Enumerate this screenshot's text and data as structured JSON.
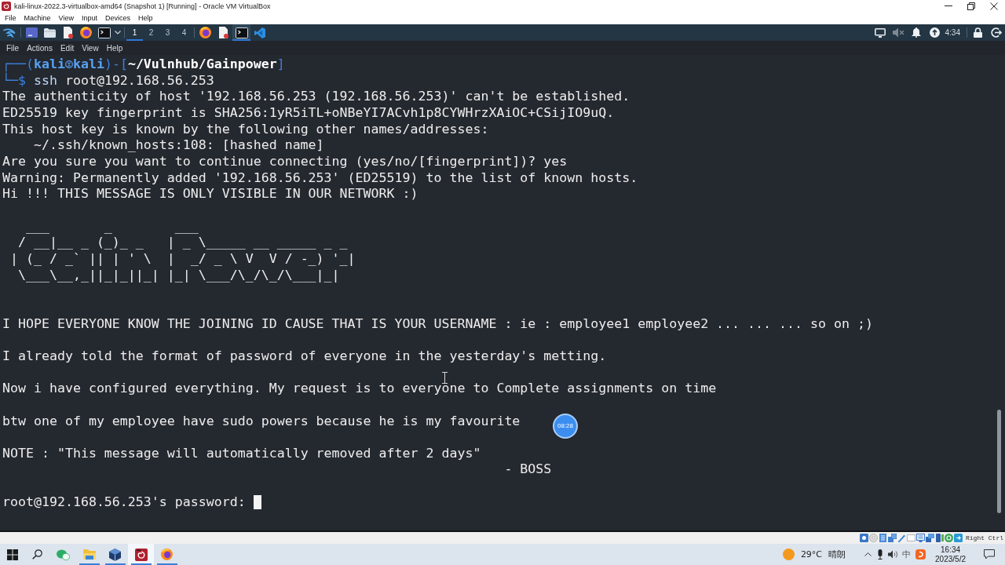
{
  "vm_window": {
    "title": "kali-linux-2022.3-virtualbox-amd64 (Snapshot 1) [Running] - Oracle VM VirtualBox",
    "menu": [
      "File",
      "Machine",
      "View",
      "Input",
      "Devices",
      "Help"
    ],
    "host_key": "Right Ctrl"
  },
  "panel": {
    "workspaces": [
      {
        "label": "1",
        "selected": true
      },
      {
        "label": "2",
        "selected": false
      },
      {
        "label": "3",
        "selected": false
      },
      {
        "label": "4",
        "selected": false
      }
    ],
    "windows": [
      {
        "selected": false
      },
      {
        "selected": false
      },
      {
        "selected": true
      },
      {
        "selected": false
      }
    ],
    "clock": "4:34"
  },
  "terminal": {
    "menu": [
      "File",
      "Actions",
      "Edit",
      "View",
      "Help"
    ],
    "lines": [
      {
        "kind": "prompt",
        "segments": [
          {
            "kind": "frame",
            "text": "┌──("
          },
          {
            "kind": "user",
            "text": "kali"
          },
          {
            "kind": "symbol"
          },
          {
            "kind": "host",
            "text": "kali"
          },
          {
            "kind": "frame",
            "text": ")-["
          },
          {
            "kind": "path",
            "text": "~/Vulnhub/Gainpower"
          },
          {
            "kind": "frame",
            "text": "]"
          }
        ]
      },
      {
        "kind": "prompt",
        "segments": [
          {
            "kind": "frame",
            "text": "└─$"
          },
          {
            "kind": "command",
            "text": "ssh"
          },
          {
            "kind": "argument",
            "text": "root@192.168.56.253"
          }
        ]
      },
      {
        "kind": "output",
        "text": "The authenticity of host '192.168.56.253 (192.168.56.253)' can't be established."
      },
      {
        "kind": "output",
        "text": "ED25519 key fingerprint is SHA256:1yR5iTL+oNBeYI7ACvh1p8CYWHrzXAiOC+CSijIO9uQ."
      },
      {
        "kind": "output",
        "text": "This host key is known by the following other names/addresses:"
      },
      {
        "kind": "indented",
        "text": "~/.ssh/known_hosts:108: [hashed name]"
      },
      {
        "kind": "output",
        "text": "Are you sure you want to continue connecting (yes/no/[fingerprint])? yes"
      },
      {
        "kind": "output",
        "text": "Warning: Permanently added '192.168.56.253' (ED25519) to the list of known hosts."
      },
      {
        "kind": "output",
        "text": "Hi !!! THIS MESSAGE IS ONLY VISIBLE IN OUR NETWORK :)"
      },
      {
        "kind": "blank"
      },
      {
        "kind": "art",
        "rows": [
          "   ___       _        ___",
          "  / __|__ _ (_)_ _   | _ \\_____ __ _____ _ _",
          " | (_ / _` || | ' \\  |  _/ _ \\ V  V / -_) '_|",
          "  \\___\\__,_||_|_||_| |_| \\___/\\_/\\_/\\___|_|"
        ]
      },
      {
        "kind": "blank"
      },
      {
        "kind": "blank"
      },
      {
        "kind": "output",
        "text": "I HOPE EVERYONE KNOW THE JOINING ID CAUSE THAT IS YOUR USERNAME : ie : employee1 employee2 ... ... ... so on ;)"
      },
      {
        "kind": "blank"
      },
      {
        "kind": "output",
        "text": "I already told the format of password of everyone in the yesterday's metting."
      },
      {
        "kind": "blank"
      },
      {
        "kind": "output",
        "text": "Now i have configured everything. My request is to everyone to Complete assignments on time"
      },
      {
        "kind": "blank"
      },
      {
        "kind": "output",
        "text": "btw one of my employee have sudo powers because he is my favourite"
      },
      {
        "kind": "blank"
      },
      {
        "kind": "output",
        "text": "NOTE : \"This message will automatically removed after 2 days\""
      },
      {
        "kind": "signature",
        "text": "- BOSS"
      },
      {
        "kind": "blank"
      },
      {
        "kind": "password",
        "text": "root@192.168.56.253's password:"
      }
    ]
  },
  "recording_timer": "08:28",
  "taskbar": {
    "apps": [
      {
        "running": false,
        "selected": false
      },
      {
        "running": true,
        "selected": false
      },
      {
        "running": true,
        "selected": false
      },
      {
        "running": true,
        "selected": true
      },
      {
        "running": true,
        "selected": false
      }
    ],
    "weather": {
      "temperature": "29°C",
      "condition": "晴朗"
    },
    "input_method": "中",
    "time": "16:34",
    "date": "2023/5/2"
  }
}
